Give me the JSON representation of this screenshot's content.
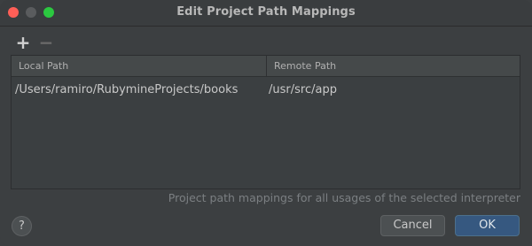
{
  "window": {
    "title": "Edit Project Path Mappings"
  },
  "toolbar": {
    "add_label": "+",
    "remove_label": "−"
  },
  "table": {
    "columns": [
      "Local Path",
      "Remote Path"
    ],
    "rows": [
      {
        "local_path": "/Users/ramiro/RubymineProjects/books",
        "remote_path": "/usr/src/app"
      }
    ]
  },
  "hint": "Project path mappings for all usages of the selected interpreter",
  "footer": {
    "help_label": "?",
    "cancel_label": "Cancel",
    "ok_label": "OK"
  },
  "colors": {
    "background": "#3c3f41",
    "primary_button": "#365880",
    "close": "#fe5f57",
    "maximize": "#2bc840"
  }
}
